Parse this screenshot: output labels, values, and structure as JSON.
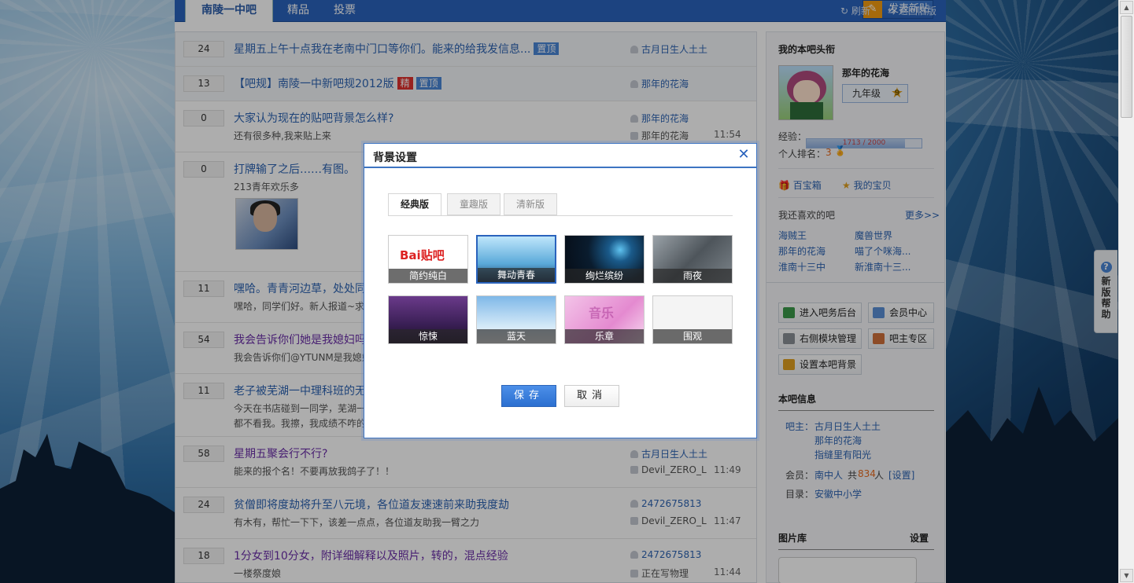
{
  "nav": {
    "tabs": [
      "南陵一中吧",
      "精品",
      "投票"
    ],
    "new_post": "发表新贴",
    "refresh": "刷新",
    "old_version": "返回旧版"
  },
  "threads": [
    {
      "count": "24",
      "title": "星期五上午十点我在老南中门口等你们。能来的给我发信息...",
      "tags": [
        "置顶"
      ],
      "author": "古月日生人土土",
      "abstract": "",
      "last_user": "",
      "time": ""
    },
    {
      "count": "13",
      "title": "【吧规】南陵一中新吧规2012版",
      "tags": [
        "精",
        "置顶"
      ],
      "author": "那年的花海",
      "abstract": "",
      "last_user": "",
      "time": ""
    },
    {
      "count": "0",
      "title": "大家认为现在的贴吧背景怎么样?",
      "tags": [],
      "author": "那年的花海",
      "abstract": "还有很多种,我来贴上来",
      "last_user": "那年的花海",
      "time": "11:54"
    },
    {
      "count": "0",
      "title": "打牌输了之后……有图。",
      "tags": [],
      "author": "",
      "abstract": "213青年欢乐多",
      "last_user": "",
      "time": ""
    },
    {
      "count": "11",
      "title": "嘿哈。青青河边草，处处同",
      "tags": [],
      "author": "",
      "abstract": "嘿哈，同学们好。新人报道~求",
      "last_user": "",
      "time": ""
    },
    {
      "count": "54",
      "title": "我会告诉你们她是我媳妇吗",
      "tags": [],
      "author": "",
      "abstract": "我会告诉你们@YTUNM是我媳妇",
      "last_user": "",
      "time": ""
    },
    {
      "count": "11",
      "title": "老子被芜湖一中理科班的无",
      "tags": [],
      "author": "",
      "abstract": "今天在书店碰到一同学，芜湖一",
      "abstract2": "都不看我。我擦，我成绩不咋的",
      "last_user": "",
      "time": ""
    },
    {
      "count": "58",
      "title": "星期五聚会行不行?",
      "tags": [],
      "author": "古月日生人土土",
      "abstract": "能来的报个名！不要再放我鸽子了！！",
      "last_user": "Devil_ZERO_L",
      "time": "11:49"
    },
    {
      "count": "24",
      "title": "贫僧即将度劫将升至八元境，各位道友速速前来助我度劫",
      "tags": [],
      "author": "2472675813",
      "abstract": "有木有，帮忙一下下，该差一点点，各位道友助我一臂之力",
      "last_user": "Devil_ZERO_L",
      "time": "11:47"
    },
    {
      "count": "18",
      "title": "1分女到10分女，附详细解释以及照片，转的，混点经验",
      "tags": [],
      "author": "2472675813",
      "abstract": "一楼祭度娘",
      "last_user": "正在写物理",
      "time": "11:44"
    }
  ],
  "sidebar": {
    "my_title_label": "我的本吧头衔",
    "username": "那年的花海",
    "level_name": "九年级",
    "level_num": "9",
    "exp_label": "经验：",
    "exp_text": "1713 / 2000",
    "exp_progress": 0.8565,
    "rank_label": "个人排名：",
    "rank_value": "3",
    "treasure_box": "百宝箱",
    "my_treasure": "我的宝贝",
    "also_like": "我还喜欢的吧",
    "more": "更多>>",
    "liked_bars": [
      "海贼王",
      "魔兽世界",
      "那年的花海",
      "喵了个咪海...",
      "淮南十三中",
      "新淮南十三..."
    ],
    "actions": [
      "进入吧务后台",
      "会员中心",
      "右侧模块管理",
      "吧主专区",
      "设置本吧背景"
    ],
    "info_title": "本吧信息",
    "owner_label": "吧主：",
    "owners": [
      "古月日生人土土",
      "那年的花海",
      "指缝里有阳光"
    ],
    "member_label": "会员：",
    "member_name": "南中人",
    "member_total_pre": "共",
    "member_count": "834",
    "member_unit": "人",
    "member_setting": "[设置]",
    "dir_label": "目录：",
    "dir_value": "安徽中小学",
    "gallery_title": "图片库",
    "gallery_setting": "设置"
  },
  "help": {
    "q": "?",
    "text": [
      "新",
      "版",
      "帮",
      "助"
    ]
  },
  "modal": {
    "title": "背景设置",
    "tabs": [
      "经典版",
      "童趣版",
      "清新版"
    ],
    "themes": [
      {
        "name": "简约纯白",
        "logo": "Bai贴吧"
      },
      {
        "name": "舞动青春"
      },
      {
        "name": "绚烂缤纷"
      },
      {
        "name": "雨夜"
      },
      {
        "name": "惊悚"
      },
      {
        "name": "蓝天"
      },
      {
        "name": "乐章",
        "deco": "音乐"
      },
      {
        "name": "围观"
      }
    ],
    "selected": "舞动青春",
    "save": "保存",
    "cancel": "取消"
  },
  "colors": {
    "accent": "#2a63bd",
    "hot_tag": "#e0312f",
    "top_tag": "#4a86d6",
    "member_count": "#e86a1e"
  }
}
